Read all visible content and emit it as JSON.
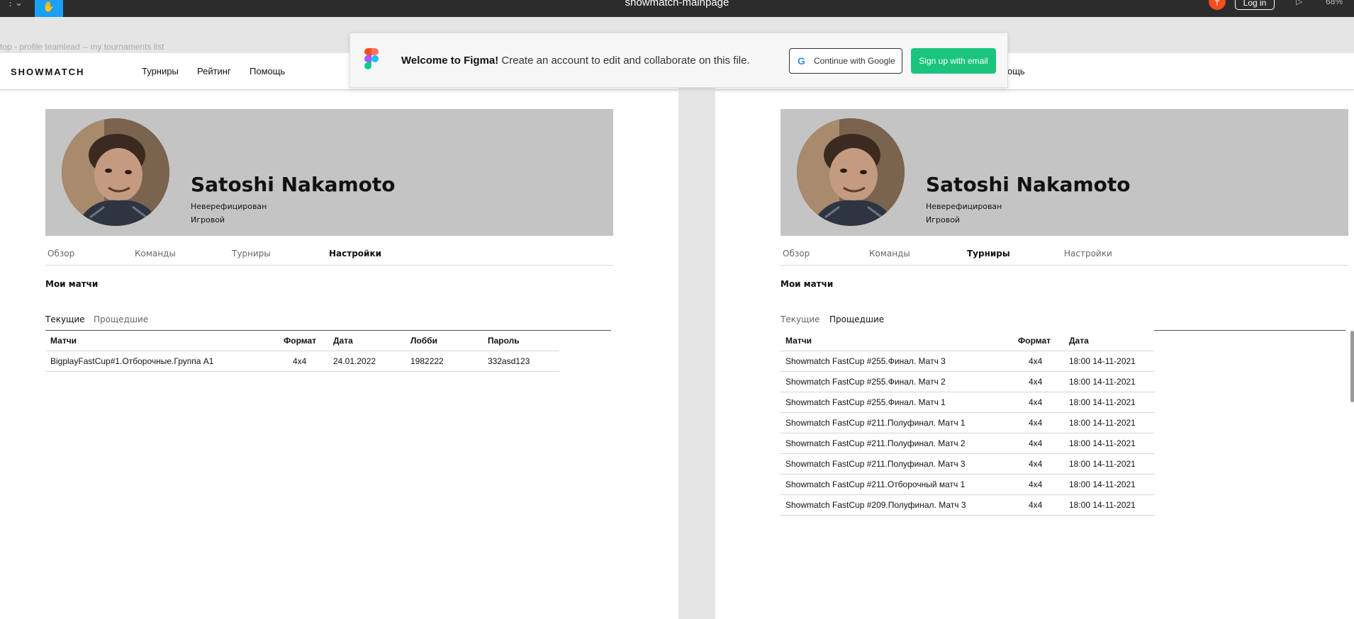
{
  "figma": {
    "file_title": "showmatch-mainpage",
    "login_label": "Log in",
    "zoom": "68%",
    "avatar_initial": "T",
    "breadcrumb": "top - profile teamlead -- my tournaments list",
    "welcome": {
      "title": "Welcome to Figma!",
      "message": "Create an account to edit and collaborate on this file.",
      "google_label": "Continue with Google",
      "email_label": "Sign up with email"
    }
  },
  "site": {
    "logo": "SHOWMATCH",
    "nav": [
      "Турниры",
      "Рейтинг",
      "Помощь"
    ],
    "nav_tail_right": "ощь"
  },
  "profile": {
    "name": "Satoshi Nakamoto",
    "status": "Неверефицирован",
    "type": "Игровой"
  },
  "profile_tabs": [
    "Обзор",
    "Команды",
    "Турниры",
    "Настройки"
  ],
  "section_title": "Мои  матчи",
  "match_tabs": [
    "Текущие",
    "Прощедшие"
  ],
  "current_matches": {
    "headers": [
      "Матчи",
      "Формат",
      "Дата",
      "Лобби",
      "Пароль"
    ],
    "rows": [
      [
        "BigplayFastCup#1.Отборочные.Группа A1",
        "4x4",
        "24.01.2022",
        "1982222",
        "332asd123"
      ]
    ]
  },
  "past_matches": {
    "headers": [
      "Матчи",
      "Формат",
      "Дата"
    ],
    "rows": [
      [
        "Showmatch FastCup #255.Финал. Матч 3",
        "4x4",
        "18:00 14-11-2021"
      ],
      [
        "Showmatch FastCup #255.Финал. Матч 2",
        "4x4",
        "18:00 14-11-2021"
      ],
      [
        "Showmatch FastCup #255.Финал. Матч 1",
        "4x4",
        "18:00 14-11-2021"
      ],
      [
        "Showmatch FastCup #211.Полуфинал. Матч 1",
        "4x4",
        "18:00 14-11-2021"
      ],
      [
        "Showmatch FastCup #211.Полуфинал. Матч 2",
        "4x4",
        "18:00 14-11-2021"
      ],
      [
        "Showmatch FastCup #211.Полуфинал. Матч 3",
        "4x4",
        "18:00 14-11-2021"
      ],
      [
        "Showmatch FastCup #211.Отборочный матч 1",
        "4x4",
        "18:00 14-11-2021"
      ],
      [
        "Showmatch FastCup #209.Полуфинал. Матч 3",
        "4x4",
        "18:00 14-11-2021"
      ]
    ]
  }
}
